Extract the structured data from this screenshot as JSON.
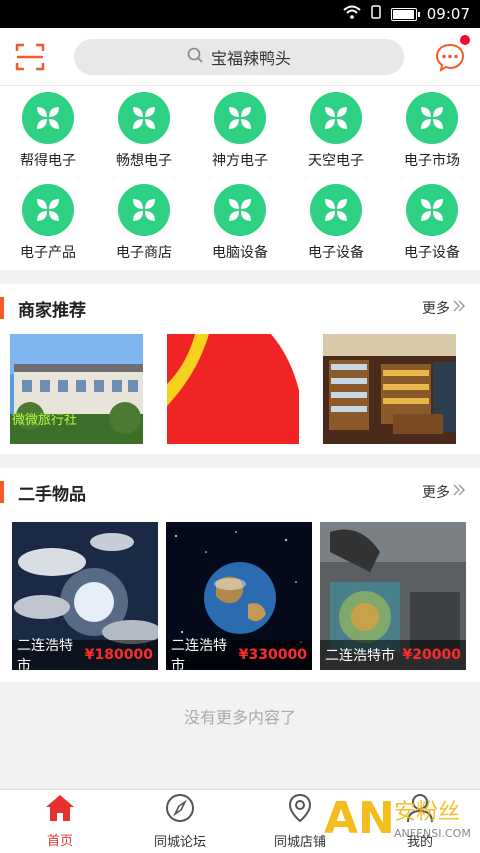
{
  "status_bar": {
    "time": "09:07"
  },
  "header": {
    "search_text": "宝福辣鸭头"
  },
  "categories": [
    {
      "label": "帮得电子"
    },
    {
      "label": "畅想电子"
    },
    {
      "label": "神方电子"
    },
    {
      "label": "天空电子"
    },
    {
      "label": "电子市场"
    },
    {
      "label": "电子产品"
    },
    {
      "label": "电子商店"
    },
    {
      "label": "电脑设备"
    },
    {
      "label": "电子设备"
    },
    {
      "label": "电子设备"
    }
  ],
  "merchants": {
    "title": "商家推荐",
    "more": "更多",
    "cards": [
      {
        "caption": "微微旅行社"
      },
      {
        "caption": ""
      },
      {
        "caption": ""
      }
    ]
  },
  "secondhand": {
    "title": "二手物品",
    "more": "更多",
    "items": [
      {
        "city": "二连浩特市",
        "price": "¥180000"
      },
      {
        "city": "二连浩特市",
        "price": "¥330000"
      },
      {
        "city": "二连浩特市",
        "price": "¥20000"
      }
    ]
  },
  "no_more": "没有更多内容了",
  "tabbar": {
    "tabs": [
      {
        "label": "首页",
        "icon": "home-icon",
        "active": true
      },
      {
        "label": "同城论坛",
        "icon": "compass-icon"
      },
      {
        "label": "同城店铺",
        "icon": "location-icon"
      },
      {
        "label": "我的",
        "icon": "user-icon"
      }
    ]
  },
  "watermark": {
    "brand": "安粉丝",
    "letters": "AN",
    "site": "ANFENSI.COM"
  },
  "colors": {
    "accent": "#f55a2b",
    "green": "#2ed083",
    "price": "#ff2b2b",
    "active_tab": "#e8312f"
  }
}
